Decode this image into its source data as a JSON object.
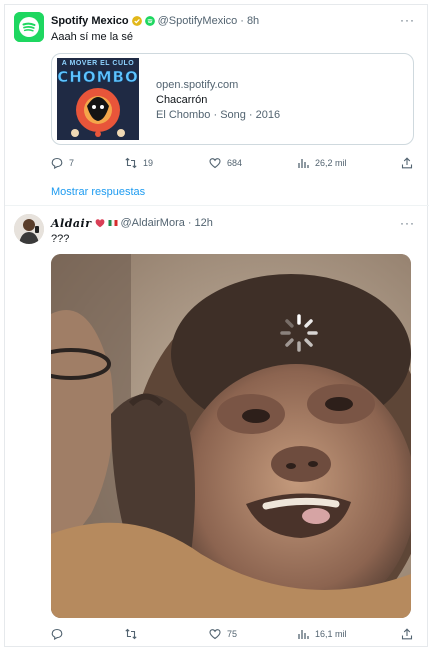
{
  "tweets": [
    {
      "author_name": "Spotify Mexico",
      "handle": "@SpotifyMexico",
      "separator": "·",
      "time": "8h",
      "text": "Aaah sí me la sé",
      "card": {
        "cover_top_text": "A MOVER EL CULO",
        "cover_logo_text": "CHOMBO",
        "domain": "open.spotify.com",
        "title": "Chacarrón",
        "subtitle": "El Chombo · Song · 2016"
      },
      "actions": {
        "replies": "7",
        "retweets": "19",
        "likes": "684",
        "views": "26,2 mil"
      },
      "show_replies": "Mostrar respuestas"
    },
    {
      "author_name": "Aldair",
      "handle": "@AldairMora",
      "separator": "·",
      "time": "12h",
      "text": "???",
      "actions": {
        "replies": "",
        "retweets": "",
        "likes": "75",
        "views": "16,1 mil"
      }
    }
  ],
  "icons": {
    "more": "more-icon",
    "reply": "reply-icon",
    "retweet": "retweet-icon",
    "like": "heart-icon",
    "views": "views-icon",
    "share": "share-icon",
    "verified": "verified-badge-icon",
    "loading": "loading-spinner-icon"
  },
  "colors": {
    "accent": "#1d9bf0",
    "spotify_green": "#1ed760",
    "muted": "#536471",
    "verified_gold": "#e2b719"
  }
}
